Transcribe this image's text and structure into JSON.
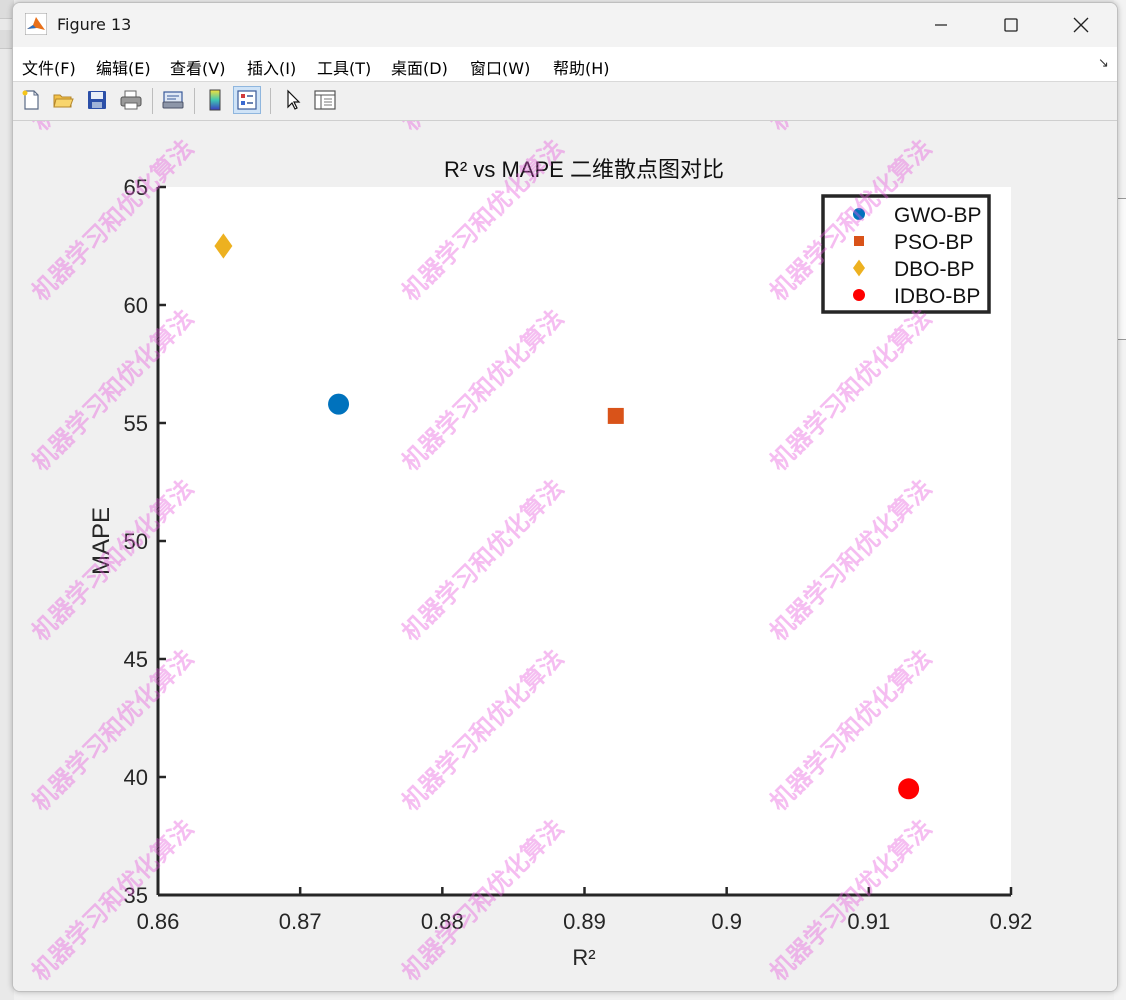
{
  "window": {
    "title": "Figure 13",
    "controls": {
      "minimize": "minimize",
      "maximize": "maximize",
      "close": "close"
    }
  },
  "menu": {
    "items": [
      "文件(F)",
      "编辑(E)",
      "查看(V)",
      "插入(I)",
      "工具(T)",
      "桌面(D)",
      "窗口(W)",
      "帮助(H)"
    ]
  },
  "toolbar": {
    "tools": [
      "new-figure-icon",
      "open-file-icon",
      "save-icon",
      "print-icon",
      "print-preview-icon",
      "colorbar-icon",
      "legend-icon",
      "pointer-icon",
      "property-inspector-icon"
    ],
    "active": "legend-icon"
  },
  "watermark_text": "机器学习和优化算法",
  "colors": {
    "gwo": "#0072BD",
    "pso": "#D95319",
    "dbo": "#EDB120",
    "idbo": "#FF0000",
    "watermark": "#E65ADC"
  },
  "chart_data": {
    "type": "scatter",
    "title": "R² vs MAPE 二维散点图对比",
    "xlabel": "R²",
    "ylabel": "MAPE",
    "xlim": [
      0.86,
      0.92
    ],
    "ylim": [
      35,
      65
    ],
    "xticks": [
      0.86,
      0.87,
      0.88,
      0.89,
      0.9,
      0.91,
      0.92
    ],
    "xtick_labels": [
      "0.86",
      "0.87",
      "0.88",
      "0.89",
      "0.9",
      "0.91",
      "0.92"
    ],
    "yticks": [
      35,
      40,
      45,
      50,
      55,
      60,
      65
    ],
    "ytick_labels": [
      "35",
      "40",
      "45",
      "50",
      "55",
      "60",
      "65"
    ],
    "grid": false,
    "legend_position": "top-right",
    "series": [
      {
        "name": "GWO-BP",
        "marker": "circle",
        "color": "#0072BD",
        "x": [
          0.8727
        ],
        "y": [
          55.8
        ]
      },
      {
        "name": "PSO-BP",
        "marker": "square",
        "color": "#D95319",
        "x": [
          0.8922
        ],
        "y": [
          55.3
        ]
      },
      {
        "name": "DBO-BP",
        "marker": "diamond",
        "color": "#EDB120",
        "x": [
          0.8646
        ],
        "y": [
          62.5
        ]
      },
      {
        "name": "IDBO-BP",
        "marker": "circle",
        "color": "#FF0000",
        "x": [
          0.9128
        ],
        "y": [
          39.5
        ]
      }
    ]
  }
}
